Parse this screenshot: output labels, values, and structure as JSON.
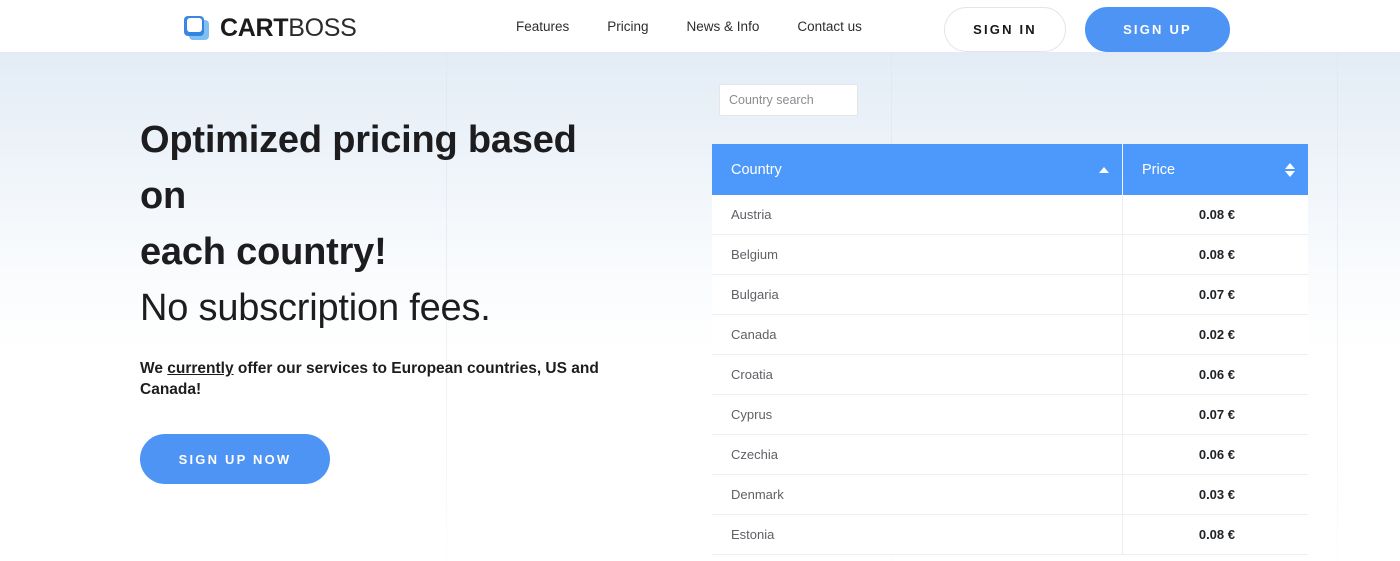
{
  "header": {
    "logo": {
      "mark_icon": "cartboss-logo-icon",
      "text_bold": "CART",
      "text_light": "BOSS"
    },
    "nav": [
      {
        "label": "Features"
      },
      {
        "label": "Pricing"
      },
      {
        "label": "News & Info"
      },
      {
        "label": "Contact us"
      }
    ],
    "sign_in_label": "SIGN IN",
    "sign_up_label": "SIGN UP"
  },
  "hero": {
    "headline_line1": "Optimized pricing based on",
    "headline_line2": "each country!",
    "headline_line3": "No subscription fees.",
    "sub_prefix": "We ",
    "sub_underlined": "currently",
    "sub_rest": " offer our services to European countries, US and Canada!",
    "cta_label": "SIGN UP NOW"
  },
  "pricing_table": {
    "search_placeholder": "Country search",
    "search_value": "",
    "columns": [
      {
        "label": "Country",
        "sort_icon": "sort-asc-icon",
        "sort_state": "asc"
      },
      {
        "label": "Price",
        "sort_icon": "sort-both-icon",
        "sort_state": "none"
      }
    ],
    "rows": [
      {
        "country": "Austria",
        "price": "0.08 €"
      },
      {
        "country": "Belgium",
        "price": "0.08 €"
      },
      {
        "country": "Bulgaria",
        "price": "0.07 €"
      },
      {
        "country": "Canada",
        "price": "0.02 €"
      },
      {
        "country": "Croatia",
        "price": "0.06 €"
      },
      {
        "country": "Cyprus",
        "price": "0.07 €"
      },
      {
        "country": "Czechia",
        "price": "0.06 €"
      },
      {
        "country": "Denmark",
        "price": "0.03 €"
      },
      {
        "country": "Estonia",
        "price": "0.08 €"
      }
    ]
  },
  "colors": {
    "accent_blue": "#4e94f5",
    "table_header_blue": "#4c99fb",
    "text_dark": "#1d1d1f",
    "text_muted": "#5e6166"
  }
}
